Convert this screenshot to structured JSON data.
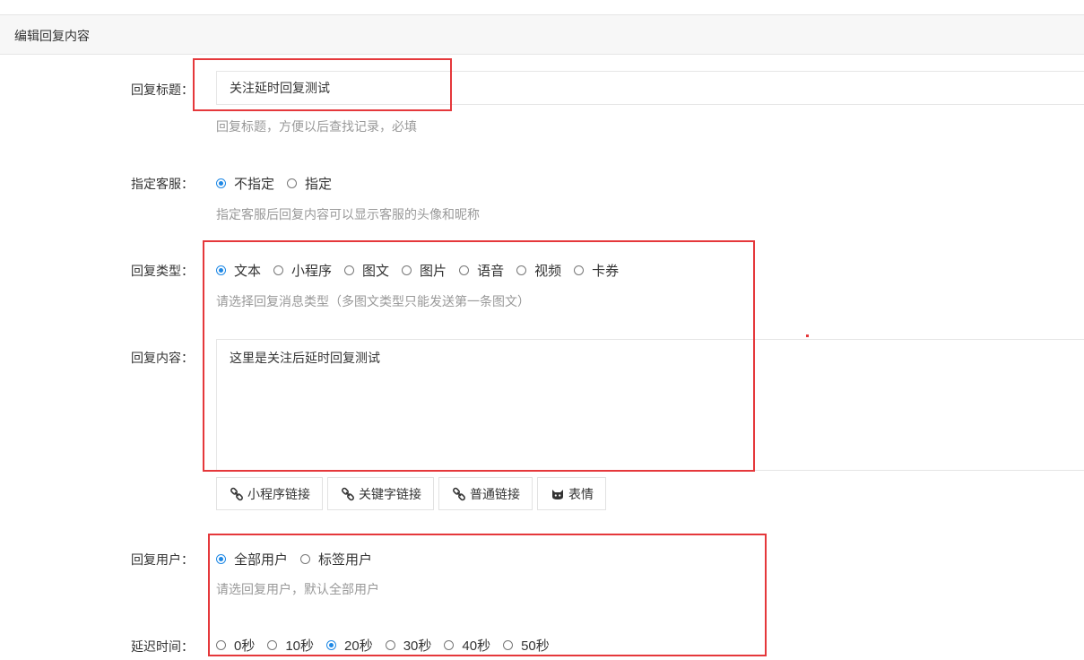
{
  "panel": {
    "title": "编辑回复内容"
  },
  "form": {
    "title": {
      "label": "回复标题",
      "value": "关注延时回复测试",
      "help": "回复标题，方便以后查找记录，必填"
    },
    "agent": {
      "label": "指定客服",
      "options": [
        "不指定",
        "指定"
      ],
      "selected": "不指定",
      "help": "指定客服后回复内容可以显示客服的头像和昵称"
    },
    "type": {
      "label": "回复类型",
      "options": [
        "文本",
        "小程序",
        "图文",
        "图片",
        "语音",
        "视频",
        "卡券"
      ],
      "selected": "文本",
      "help": "请选择回复消息类型（多图文类型只能发送第一条图文）"
    },
    "content": {
      "label": "回复内容",
      "value": "这里是关注后延时回复测试"
    },
    "toolbar": {
      "buttons": [
        {
          "label": "小程序链接",
          "icon": "link-icon"
        },
        {
          "label": "关键字链接",
          "icon": "link-icon"
        },
        {
          "label": "普通链接",
          "icon": "link-icon"
        },
        {
          "label": "表情",
          "icon": "emoji-icon"
        }
      ]
    },
    "users": {
      "label": "回复用户",
      "options": [
        "全部用户",
        "标签用户"
      ],
      "selected": "全部用户",
      "help": "请选回复用户，默认全部用户"
    },
    "delay": {
      "label": "延迟时间",
      "options": [
        "0秒",
        "10秒",
        "20秒",
        "30秒",
        "40秒",
        "50秒"
      ],
      "selected": "20秒"
    }
  },
  "colors": {
    "accent": "#1e88e5",
    "highlight": "#e5383b",
    "help_text": "#999999"
  }
}
